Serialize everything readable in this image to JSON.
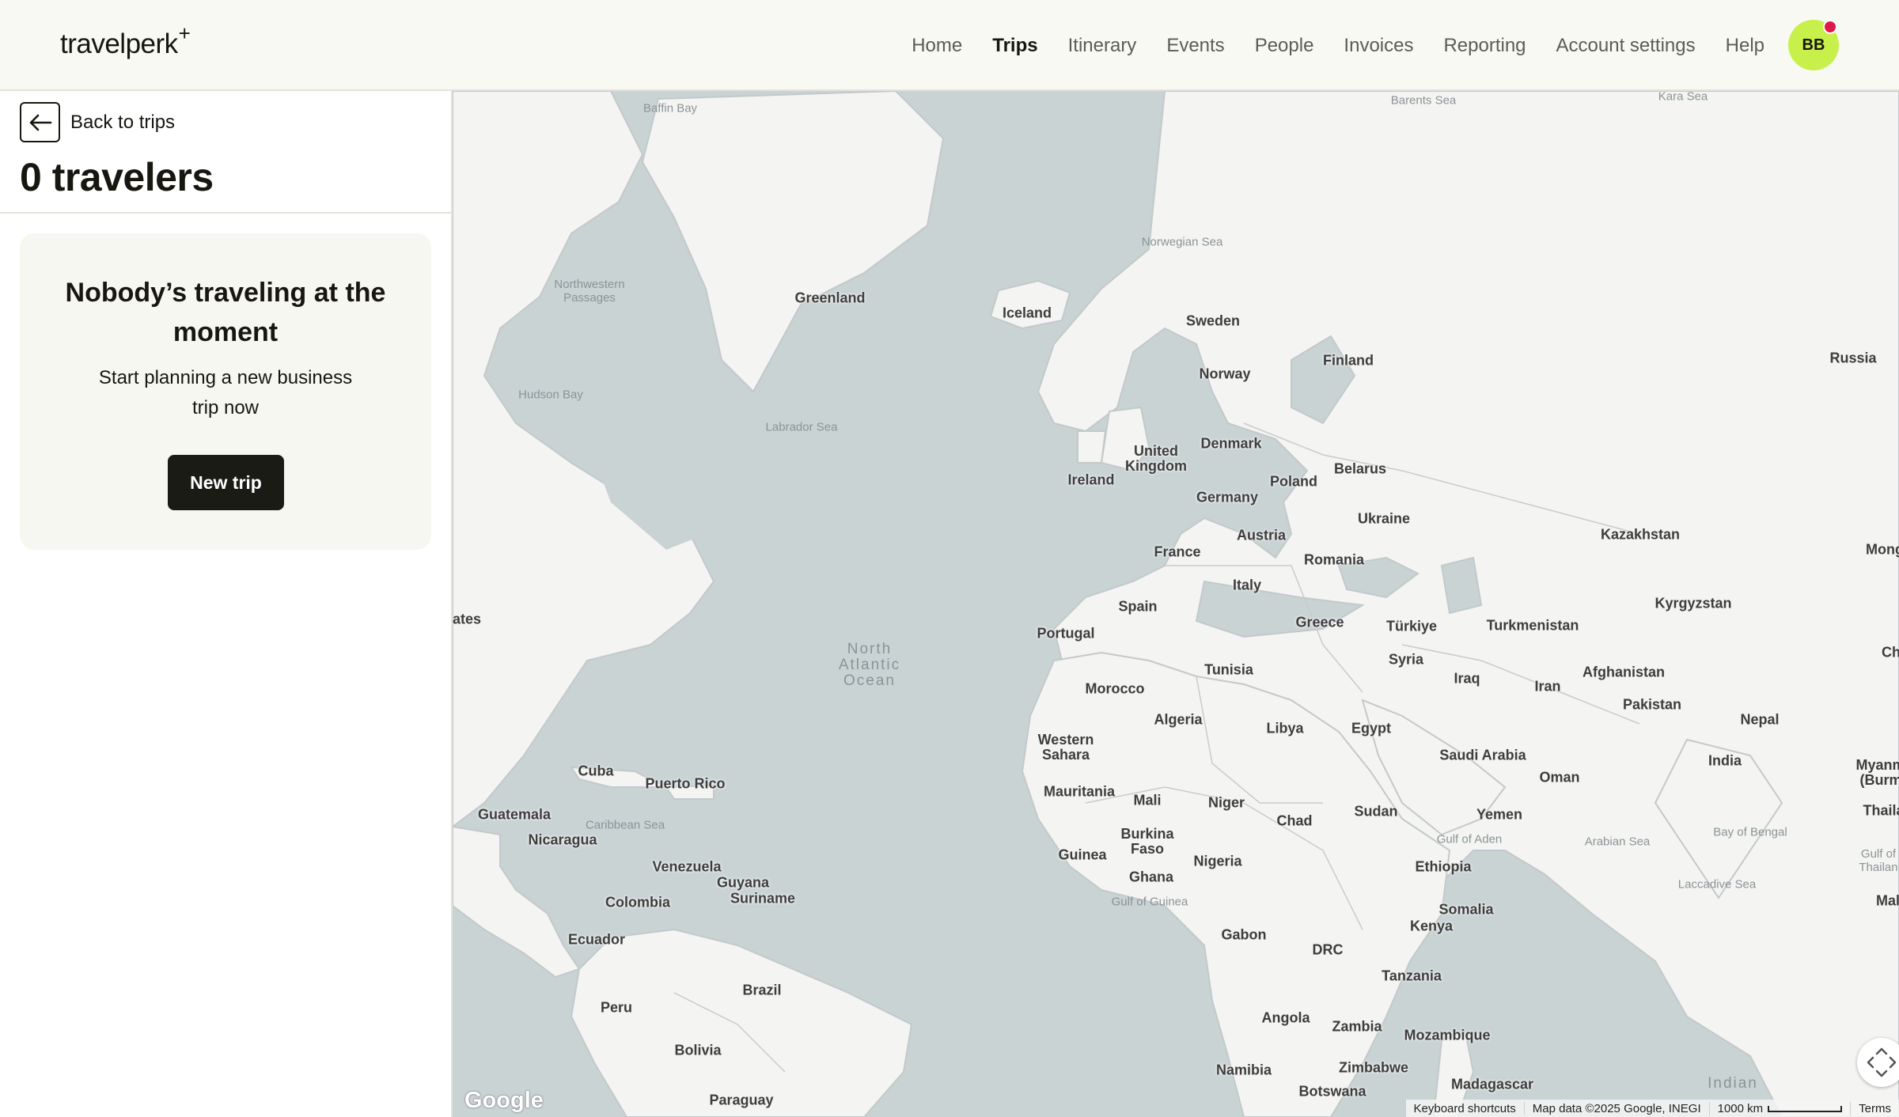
{
  "header": {
    "logo_text": "travelperk",
    "logo_plus": "+",
    "nav": [
      {
        "label": "Home",
        "active": false
      },
      {
        "label": "Trips",
        "active": true
      },
      {
        "label": "Itinerary",
        "active": false
      },
      {
        "label": "Events",
        "active": false
      },
      {
        "label": "People",
        "active": false
      },
      {
        "label": "Invoices",
        "active": false
      },
      {
        "label": "Reporting",
        "active": false
      },
      {
        "label": "Account settings",
        "active": false
      },
      {
        "label": "Help",
        "active": false
      }
    ],
    "avatar_initials": "BB",
    "avatar_color": "#c8f04a",
    "notification_color": "#e0174a"
  },
  "panel": {
    "back_label": "Back to trips",
    "back_icon": "arrow-left-icon",
    "travelers_title": "0 travelers",
    "empty_title": "Nobody’s traveling at the moment",
    "empty_subtitle": "Start planning a new business trip now",
    "new_trip_label": "New trip"
  },
  "map": {
    "countries": [
      "Greenland",
      "Iceland",
      "Sweden",
      "Finland",
      "Norway",
      "Russia",
      "Denmark",
      "United Kingdom",
      "Ireland",
      "Belarus",
      "Poland",
      "Germany",
      "Ukraine",
      "Kazakhstan",
      "Austria",
      "France",
      "Romania",
      "Italy",
      "Spain",
      "Portugal",
      "Greece",
      "Türkiye",
      "Turkmenistan",
      "Kyrgyzstan",
      "Mong",
      "Tunisia",
      "Syria",
      "Iraq",
      "Afghanistan",
      "Iran",
      "Pakistan",
      "Ch",
      "Morocco",
      "Algeria",
      "Libya",
      "Egypt",
      "Nepal",
      "Western Sahara",
      "Saudi Arabia",
      "India",
      "Oman",
      "Myanmar (Burma)",
      "Cuba",
      "Puerto Rico",
      "Mauritania",
      "Mali",
      "Niger",
      "Sudan",
      "Chad",
      "Yemen",
      "Thailar",
      "Guatemala",
      "Nicaragua",
      "Burkina Faso",
      "Guinea",
      "Nigeria",
      "Ghana",
      "Ethiopia",
      "Venezuela",
      "Guyana",
      "Suriname",
      "Colombia",
      "Somalia",
      "Kenya",
      "Ecuador",
      "Gabon",
      "DRC",
      "Tanzania",
      "Brazil",
      "Peru",
      "Angola",
      "Zambia",
      "Mozambique",
      "Bolivia",
      "Namibia",
      "Zimbabwe",
      "Madagascar",
      "Paraguay",
      "Botswana",
      "ates",
      "Mal"
    ],
    "seas": [
      "Baffin Bay",
      "Barents Sea",
      "Kara Sea",
      "Norwegian Sea",
      "Northwestern Passages",
      "Hudson Bay",
      "Labrador Sea",
      "Caribbean Sea",
      "Gulf of Aden",
      "Arabian Sea",
      "Bay of Bengal",
      "Gulf of Guinea",
      "Laccadive Sea",
      "Gulf of Thailan"
    ],
    "oceans": [
      "North Atlantic Ocean",
      "Indian"
    ],
    "google_logo": "Google",
    "attribution": {
      "shortcuts": "Keyboard shortcuts",
      "data": "Map data ©2025 Google, INEGI",
      "scale": "1000 km",
      "terms": "Terms"
    }
  }
}
